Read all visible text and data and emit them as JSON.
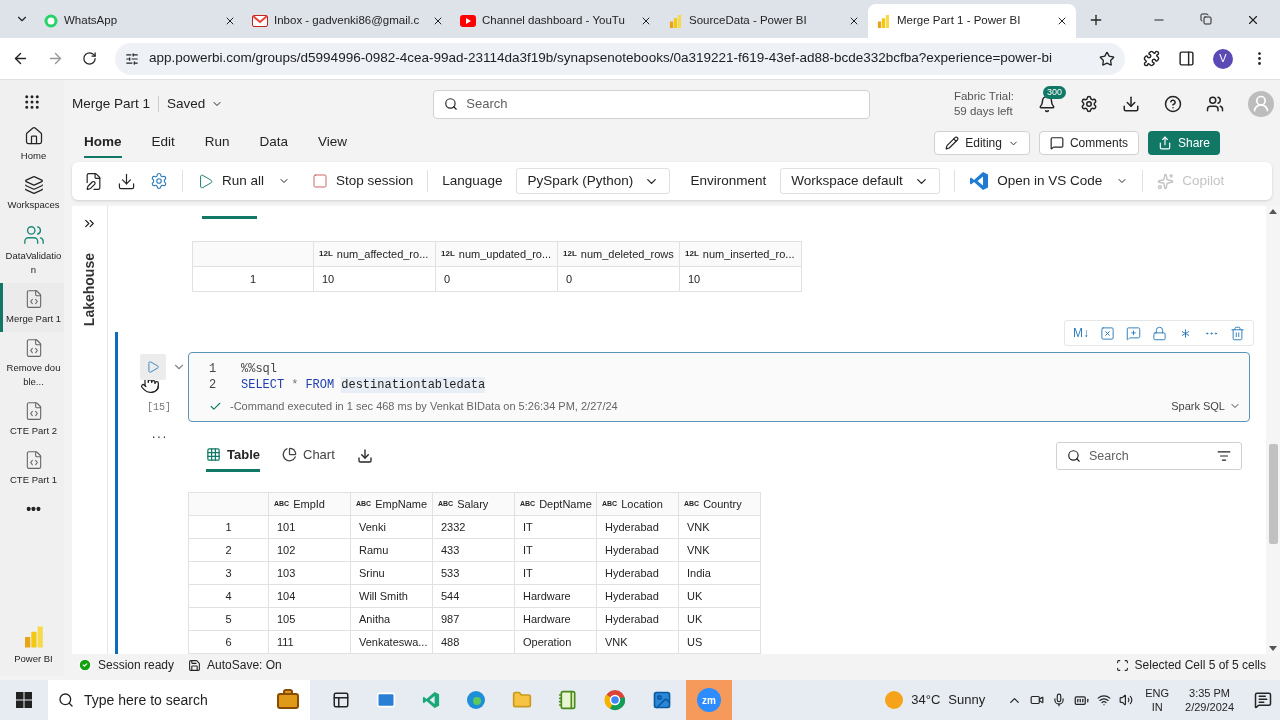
{
  "browser": {
    "tabs": [
      {
        "title": "WhatsApp",
        "kind": "whatsapp",
        "selected": false
      },
      {
        "title": "Inbox - gadvenki86@gmail.c",
        "kind": "gmail",
        "selected": false
      },
      {
        "title": "Channel dashboard - YouTu",
        "kind": "youtube",
        "selected": false
      },
      {
        "title": "SourceData - Power BI",
        "kind": "powerbi",
        "selected": false
      },
      {
        "title": "Merge Part 1 - Power BI",
        "kind": "powerbi",
        "selected": true
      }
    ],
    "url": "app.powerbi.com/groups/d5994996-0982-4cea-99ad-23114da3f19b/synapsenotebooks/0a319221-f619-43ef-ad88-bcde332bcfba?experience=power-bi",
    "profile": "V"
  },
  "header": {
    "title": "Merge Part 1",
    "saved": "Saved",
    "search_placeholder": "Search",
    "trial": [
      "Fabric Trial:",
      "59 days left"
    ],
    "notifications": "300"
  },
  "rail": [
    {
      "label": "Home",
      "kind": "home",
      "selected": false
    },
    {
      "label": "Workspaces",
      "kind": "workspaces",
      "selected": false
    },
    {
      "label": "DataValidation",
      "kind": "people",
      "selected": false
    },
    {
      "label": "Merge Part 1",
      "kind": "notebook",
      "selected": true
    },
    {
      "label": "Remove double...",
      "kind": "notebook",
      "selected": false
    },
    {
      "label": "CTE Part 2",
      "kind": "notebook",
      "selected": false
    },
    {
      "label": "CTE Part 1",
      "kind": "notebook",
      "selected": false
    },
    {
      "label": "•••",
      "kind": "more",
      "selected": false
    },
    {
      "label": "Power BI",
      "kind": "powerbi",
      "selected": false
    }
  ],
  "ribbon_tabs": [
    {
      "label": "Home",
      "selected": true
    },
    {
      "label": "Edit",
      "selected": false
    },
    {
      "label": "Run",
      "selected": false
    },
    {
      "label": "Data",
      "selected": false
    },
    {
      "label": "View",
      "selected": false
    }
  ],
  "actions": {
    "editing": "Editing",
    "comments": "Comments",
    "share": "Share"
  },
  "toolbar": {
    "run_all": "Run all",
    "stop_session": "Stop session",
    "language_label": "Language",
    "language": "PySpark (Python)",
    "environment_label": "Environment",
    "environment": "Workspace default",
    "vscode": "Open in VS Code",
    "copilot": {
      "label": "Copilot",
      "disabled": true
    }
  },
  "lakehouse": "Lakehouse",
  "previous_output": {
    "columns": [
      null,
      {
        "type": "12L",
        "name": "num_affected_ro..."
      },
      {
        "type": "12L",
        "name": "num_updated_ro..."
      },
      {
        "type": "12L",
        "name": "num_deleted_rows"
      },
      {
        "type": "12L",
        "name": "num_inserted_ro..."
      }
    ],
    "rows": [
      [
        "1",
        "10",
        "0",
        "0",
        "10"
      ]
    ]
  },
  "cell": {
    "toolbar_markdown": "M↓",
    "lines": [
      {
        "number": "1",
        "tokens": [
          {
            "kind": "magic",
            "text": "%%sql"
          }
        ]
      },
      {
        "number": "2",
        "tokens": [
          {
            "kind": "keyword",
            "text": "SELECT"
          },
          {
            "kind": "operator",
            "text": "*"
          },
          {
            "kind": "keyword",
            "text": "FROM"
          },
          {
            "kind": "identifier",
            "text": "destinationtabledata"
          }
        ]
      }
    ],
    "execution_count": "[15]",
    "status": "-Command executed in 1 sec 468 ms by Venkat BIData on 5:26:34 PM, 2/27/24",
    "language": "Spark SQL",
    "more": "..."
  },
  "output": {
    "tabs": [
      {
        "label": "Table",
        "kind": "table",
        "selected": true
      },
      {
        "label": "Chart",
        "kind": "chart",
        "selected": false
      }
    ],
    "search_placeholder": "Search",
    "columns": [
      null,
      {
        "type": "ABC",
        "name": "EmpId"
      },
      {
        "type": "ABC",
        "name": "EmpName"
      },
      {
        "type": "ABC",
        "name": "Salary"
      },
      {
        "type": "ABC",
        "name": "DeptName"
      },
      {
        "type": "ABC",
        "name": "Location"
      },
      {
        "type": "ABC",
        "name": "Country"
      }
    ],
    "rows": [
      [
        "1",
        "101",
        "Venki",
        "2332",
        "IT",
        "Hyderabad",
        "VNK"
      ],
      [
        "2",
        "102",
        "Ramu",
        "433",
        "IT",
        "Hyderabad",
        "VNK"
      ],
      [
        "3",
        "103",
        "Srinu",
        "533",
        "IT",
        "Hyderabad",
        "India"
      ],
      [
        "4",
        "104",
        "Will Smith",
        "544",
        "Hardware",
        "Hyderabad",
        "UK"
      ],
      [
        "5",
        "105",
        "Anitha",
        "987",
        "Hardware",
        "Hyderabad",
        "UK"
      ],
      [
        "6",
        "111",
        "Venkateswa...",
        "488",
        "Operation",
        "VNK",
        "US"
      ]
    ]
  },
  "status_bar": {
    "session": "Session ready",
    "autosave": "AutoSave: On",
    "selection": "Selected Cell 5 of 5 cells"
  },
  "taskbar": {
    "search_placeholder": "Type here to search",
    "zoom": "zm",
    "temperature": "34°C",
    "weather": "Sunny",
    "lang": [
      "ENG",
      "IN"
    ],
    "time": "3:35 PM",
    "date": "2/29/2024"
  }
}
